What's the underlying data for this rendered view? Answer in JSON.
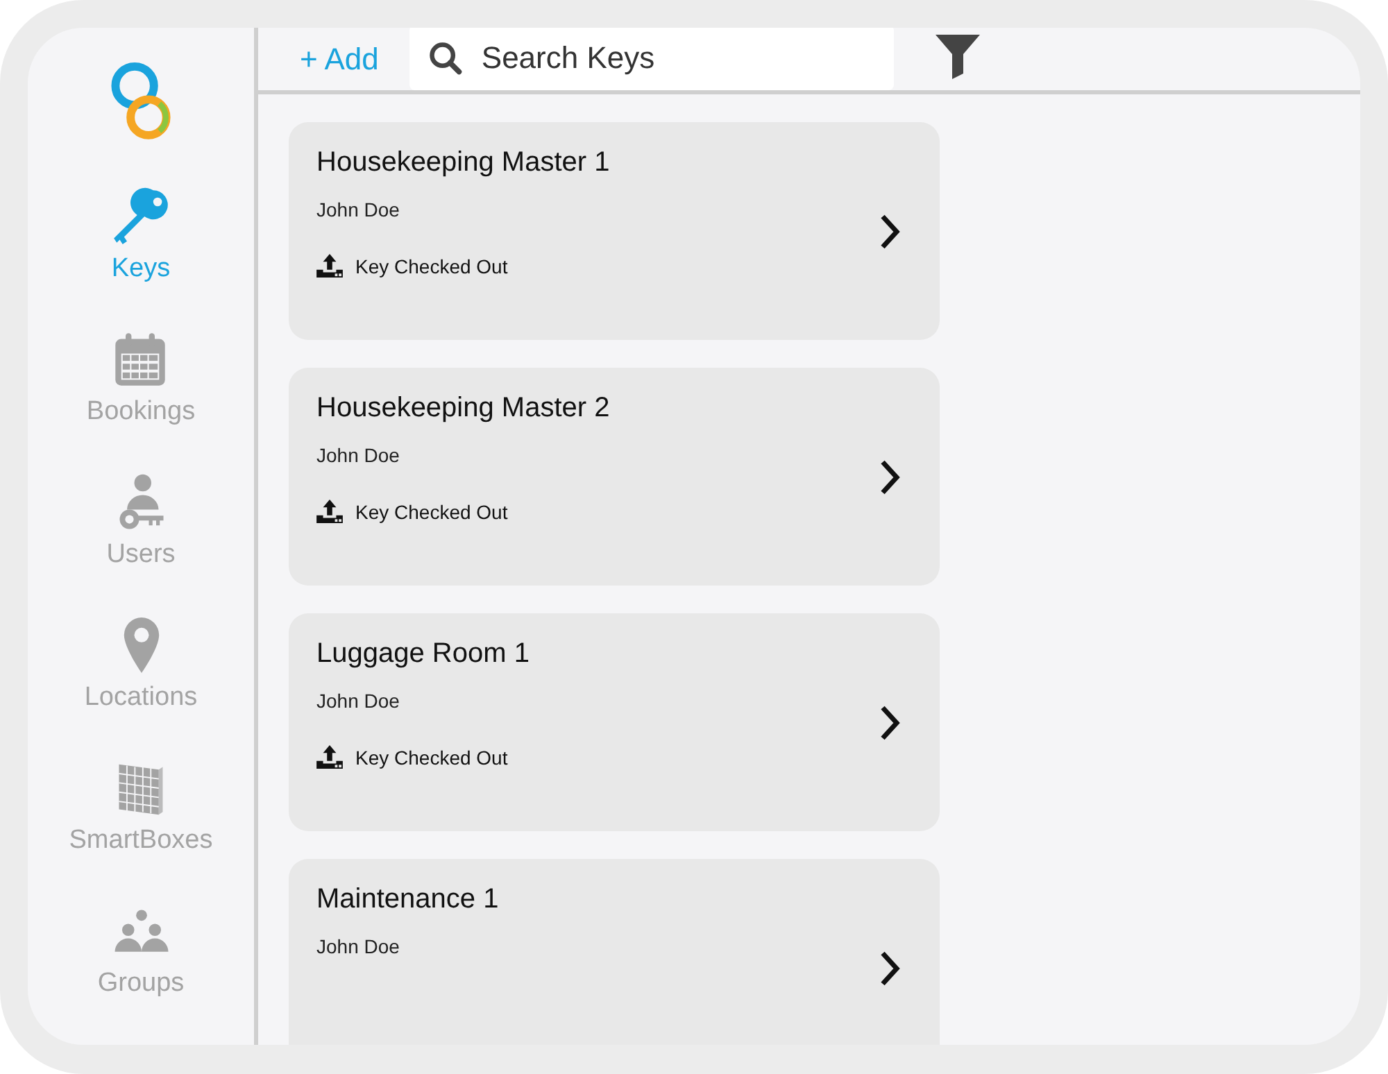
{
  "sidebar": {
    "items": [
      {
        "label": "Keys",
        "kind": "key",
        "selected": true
      },
      {
        "label": "Bookings",
        "kind": "calendar",
        "selected": false
      },
      {
        "label": "Users",
        "kind": "user",
        "selected": false
      },
      {
        "label": "Locations",
        "kind": "pin",
        "selected": false
      },
      {
        "label": "SmartBoxes",
        "kind": "box",
        "selected": false
      },
      {
        "label": "Groups",
        "kind": "group",
        "selected": false
      }
    ]
  },
  "toolbar": {
    "add": "+ Add",
    "search": {
      "placeholder": "Search Keys"
    }
  },
  "keys": [
    {
      "title": "Housekeeping Master 1",
      "holder": "John Doe",
      "status": "Key Checked Out"
    },
    {
      "title": "Housekeeping Master 2",
      "holder": "John Doe",
      "status": "Key Checked Out"
    },
    {
      "title": "Luggage Room 1",
      "holder": "John Doe",
      "status": "Key Checked Out"
    },
    {
      "title": "Maintenance 1",
      "holder": "John Doe"
    }
  ]
}
